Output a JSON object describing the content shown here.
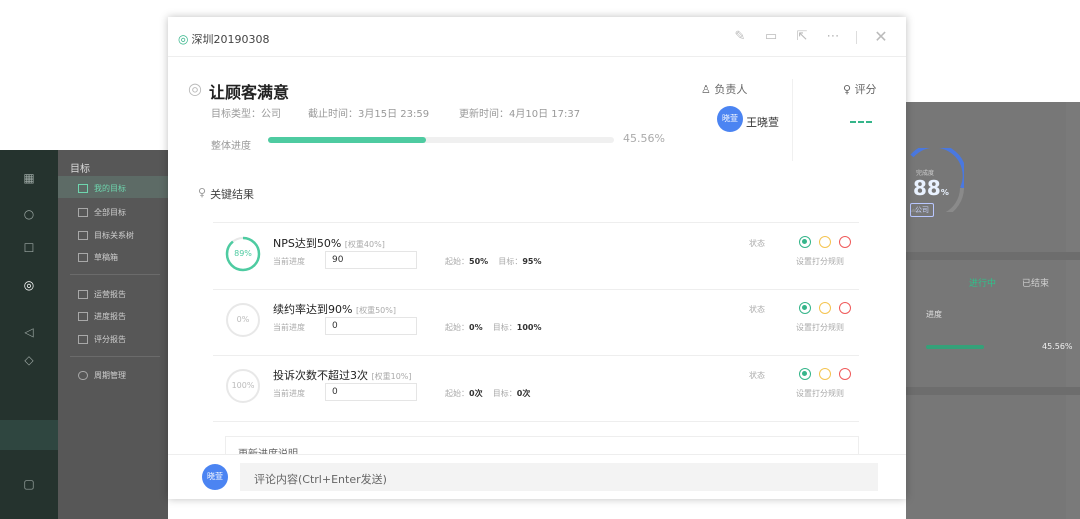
{
  "app": {
    "nav_section_title": "目标",
    "menu": [
      {
        "label": "我的目标",
        "icon": "target-icon"
      },
      {
        "label": "全部目标",
        "icon": "list-icon"
      },
      {
        "label": "目标关系树",
        "icon": "tree-icon"
      },
      {
        "label": "草稿箱",
        "icon": "draft-icon"
      },
      {
        "label": "运营报告",
        "icon": "report-icon"
      },
      {
        "label": "进度报告",
        "icon": "progress-report-icon"
      },
      {
        "label": "评分报告",
        "icon": "score-report-icon"
      },
      {
        "label": "周期管理",
        "icon": "cycle-icon"
      }
    ],
    "right_panel": {
      "gauge_label": "完成度",
      "gauge_value": "88",
      "gauge_unit": "%",
      "badge": "公司",
      "status_active": "进行中",
      "status_done": "已结束",
      "progress_label": "进度",
      "progress_value": "45.56%",
      "progress_fraction": 0.4556
    }
  },
  "modal": {
    "breadcrumb": "深圳20190308",
    "title": "让顾客满意",
    "meta_type": "目标类型：公司",
    "meta_deadline": "截止时间：3月15日 23:59",
    "meta_updated": "更新时间：4月10日 17:37",
    "overall_label": "整体进度",
    "overall_value": "45.56%",
    "overall_fraction": 0.4556,
    "owner_header": "负责人",
    "score_header": "评分",
    "owner_avatar": "晓萱",
    "owner_name": "王晓萱",
    "key_results_header": "关键结果",
    "key_results": [
      {
        "ring_text": "89%",
        "ring_fraction": 0.89,
        "title": "NPS达到50%",
        "weight": "[权重40%]",
        "current_label": "当前进度",
        "current_value": "90",
        "start_label": "起始：",
        "start_value": "50%",
        "target_label": "目标：",
        "target_value": "95%",
        "status_label": "状态",
        "rule_link": "设置打分规则"
      },
      {
        "ring_text": "0%",
        "ring_fraction": 0,
        "title": "续约率达到90%",
        "weight": "[权重50%]",
        "current_label": "当前进度",
        "current_value": "0",
        "start_label": "起始：",
        "start_value": "0%",
        "target_label": "目标：",
        "target_value": "100%",
        "status_label": "状态",
        "rule_link": "设置打分规则"
      },
      {
        "ring_text": "100%",
        "ring_fraction": 0,
        "title": "投诉次数不超过3次",
        "weight": "[权重10%]",
        "current_label": "当前进度",
        "current_value": "0",
        "start_label": "起始：",
        "start_value": "0次",
        "target_label": "目标：",
        "target_value": "0次",
        "status_label": "状态",
        "rule_link": "设置打分规则"
      }
    ],
    "update_label": "更新进度说明",
    "comment_avatar": "晓萱",
    "comment_placeholder": "评论内容(Ctrl+Enter发送)"
  },
  "colors": {
    "accent": "#4ecba1",
    "green": "#35b58a",
    "yellow": "#f5c451",
    "red": "#ef5a5a",
    "avatar": "#4b84f2"
  }
}
